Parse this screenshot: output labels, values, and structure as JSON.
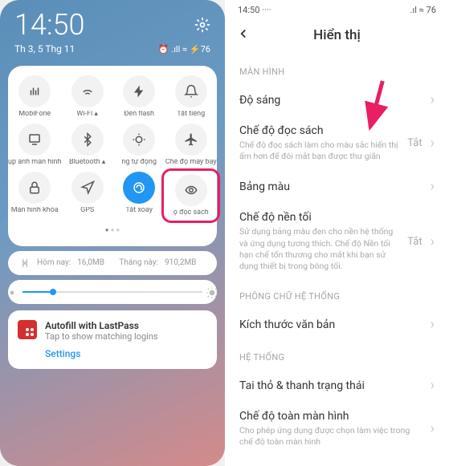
{
  "left": {
    "clock": "14:50",
    "date": "Th 3, 5 Thg 11",
    "tiles": [
      {
        "label": "MobiFone",
        "icon": "signal"
      },
      {
        "label": "Wi-Fi ▴",
        "icon": "wifi"
      },
      {
        "label": "Đèn flash",
        "icon": "flash"
      },
      {
        "label": "Tắt tiếng",
        "icon": "mute"
      },
      {
        "label": "ụp ảnh màn hình",
        "icon": "screenshot"
      },
      {
        "label": "Bluetooth ▴",
        "icon": "bt"
      },
      {
        "label": "ng tự động",
        "icon": "auto"
      },
      {
        "label": "Chế độ máy bay",
        "icon": "plane"
      },
      {
        "label": "Màn hình khóa",
        "icon": "lock"
      },
      {
        "label": "GPS",
        "icon": "gps"
      },
      {
        "label": "Tắt xoay",
        "icon": "rotate",
        "active": true
      },
      {
        "label": "ộ đọc sách",
        "icon": "read",
        "selected": true
      }
    ],
    "data_today_label": "Hôm nay:",
    "data_today": "16,0MB",
    "data_month_label": "Tháng này:",
    "data_month": "910,2MB",
    "autofill": {
      "title": "Autofill with LastPass",
      "desc": "Tap to show matching logins",
      "settings": "Settings"
    }
  },
  "right": {
    "status_time": "14:50 ····",
    "status_net": ".ıl ≈",
    "battery": "76",
    "title": "Hiển thị",
    "sec_screen": "MÀN HÌNH",
    "brightness": "Độ sáng",
    "read_mode_t": "Chế độ đọc sách",
    "read_mode_d": "Chế độ đọc sách làm cho màu sắc hiển thị ấm hơn để đôi mắt bạn được thư giãn",
    "read_mode_v": "Tắt",
    "color": "Bảng màu",
    "dark_t": "Chế độ nền tối",
    "dark_d": "Sử dụng bảng màu đen cho nền hệ thống và ứng dụng tương thích. Chế độ Nền tối hạn chế tổn thương cho mắt khi bạn sử dụng thiết bị trong bóng tối.",
    "dark_v": "Tắt",
    "sec_font": "PHÔNG CHỮ HỆ THỐNG",
    "font_size": "Kích thước văn bản",
    "sec_sys": "HỆ THỐNG",
    "notch": "Tai thỏ & thanh trạng thái",
    "full_t": "Chế độ toàn màn hình",
    "full_d": "Cho phép ứng dụng được chọn làm việc trong chế độ toàn màn hình"
  }
}
